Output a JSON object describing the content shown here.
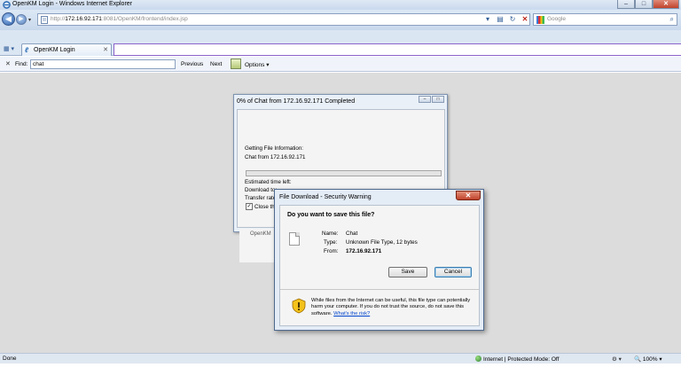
{
  "window": {
    "title": "OpenKM Login - Windows Internet Explorer",
    "controls": {
      "minimize": "–",
      "maximize": "□",
      "close": "✕"
    }
  },
  "navbar": {
    "url_prefix": "http://",
    "url_host": "172.16.92.171",
    "url_rest": ":8081/OpenKM/frontend/index.jsp",
    "search_placeholder": "Google"
  },
  "tab": {
    "label": "OpenKM Login"
  },
  "findbar": {
    "label": "Find:",
    "query": "chat",
    "previous": "Previous",
    "next": "Next",
    "options": "Options ▾"
  },
  "progress_dialog": {
    "title": "0% of Chat from 172.16.92.171 Completed",
    "getting_info": "Getting File Information:",
    "source": "Chat from 172.16.92.171",
    "progress_fraction": 0,
    "estimated_time": "Estimated time left:",
    "download_to": "Download to:",
    "transfer_rate": "Transfer rate:",
    "close_checkbox": "Close this",
    "close_checked": true
  },
  "behind_text": "OpenKM",
  "security_dialog": {
    "title": "File Download - Security Warning",
    "question": "Do you want to save this file?",
    "name_label": "Name:",
    "name_value": "Chat",
    "type_label": "Type:",
    "type_value": "Unknown File Type, 12 bytes",
    "from_label": "From:",
    "from_value": "172.16.92.171",
    "save_button": "Save",
    "cancel_button": "Cancel",
    "warning_text": "While files from the Internet can be useful, this file type can potentially harm your computer. If you do not trust the source, do not save this software.",
    "risk_link": "What's the risk?"
  },
  "statusbar": {
    "status": "Done",
    "zone": "Internet | Protected Mode: Off",
    "zoom": "100%"
  },
  "colors": {
    "titlebar": "#c9d9ee",
    "content_bg": "#dcdcdc",
    "close_red": "#c0432c",
    "link_blue": "#0044cc"
  }
}
